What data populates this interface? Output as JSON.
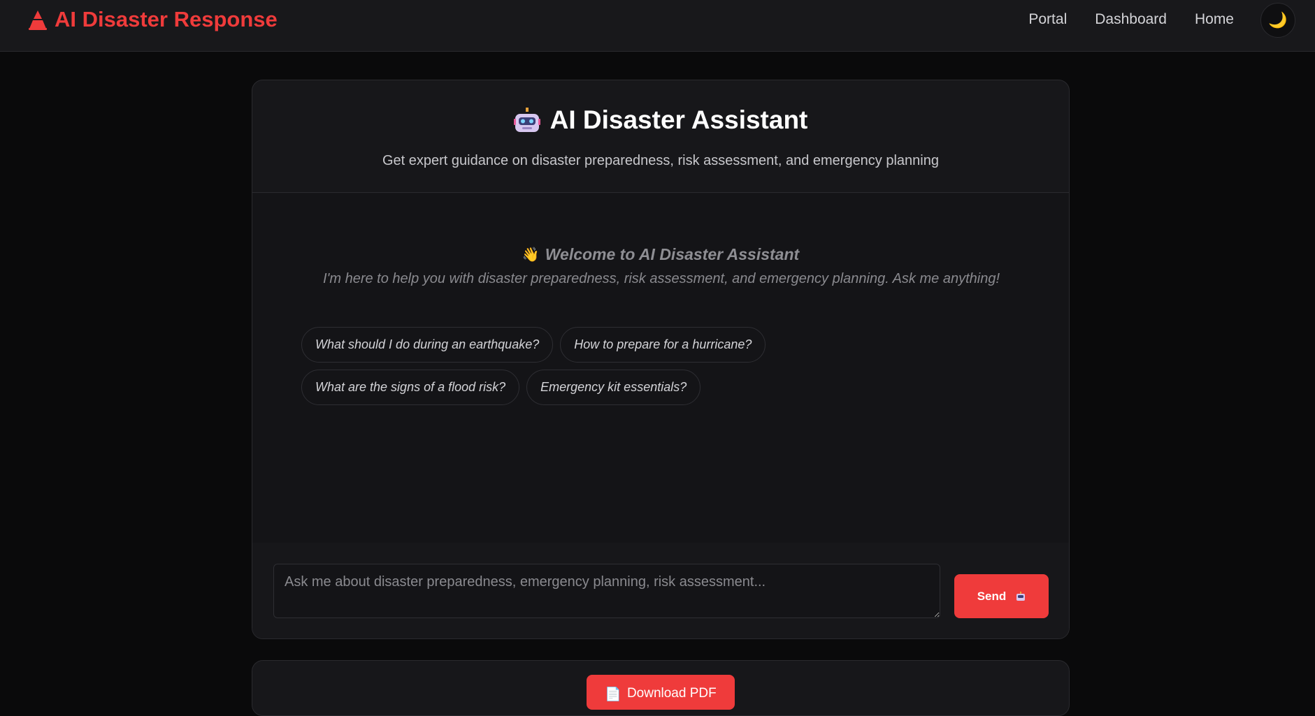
{
  "navbar": {
    "brand": "AI Disaster Response",
    "brand_icon": "cone-icon",
    "links": [
      "Portal",
      "Dashboard",
      "Home"
    ],
    "theme_toggle_icon": "moon-icon",
    "theme_toggle_glyph": "🌙"
  },
  "assistant": {
    "title": "AI Disaster Assistant",
    "title_icon": "robot-icon",
    "subtitle": "Get expert guidance on disaster preparedness, risk assessment, and emergency planning"
  },
  "welcome": {
    "icon": "wave-icon",
    "icon_glyph": "👋",
    "title": "Welcome to AI Disaster Assistant",
    "text": "I'm here to help you with disaster preparedness, risk assessment, and emergency planning. Ask me anything!"
  },
  "suggestions": [
    "What should I do during an earthquake?",
    "How to prepare for a hurricane?",
    "What are the signs of a flood risk?",
    "Emergency kit essentials?"
  ],
  "input": {
    "placeholder": "Ask me about disaster preparedness, emergency planning, risk assessment...",
    "value": ""
  },
  "send_button": {
    "label": "Send",
    "icon": "robot-icon"
  },
  "pdf_button": {
    "label": "Download PDF",
    "icon": "document-icon",
    "icon_glyph": "📄"
  },
  "colors": {
    "accent": "#ef3b3b",
    "background": "#0a0a0b",
    "card": "#17171a",
    "text": "#e5e5e7"
  }
}
